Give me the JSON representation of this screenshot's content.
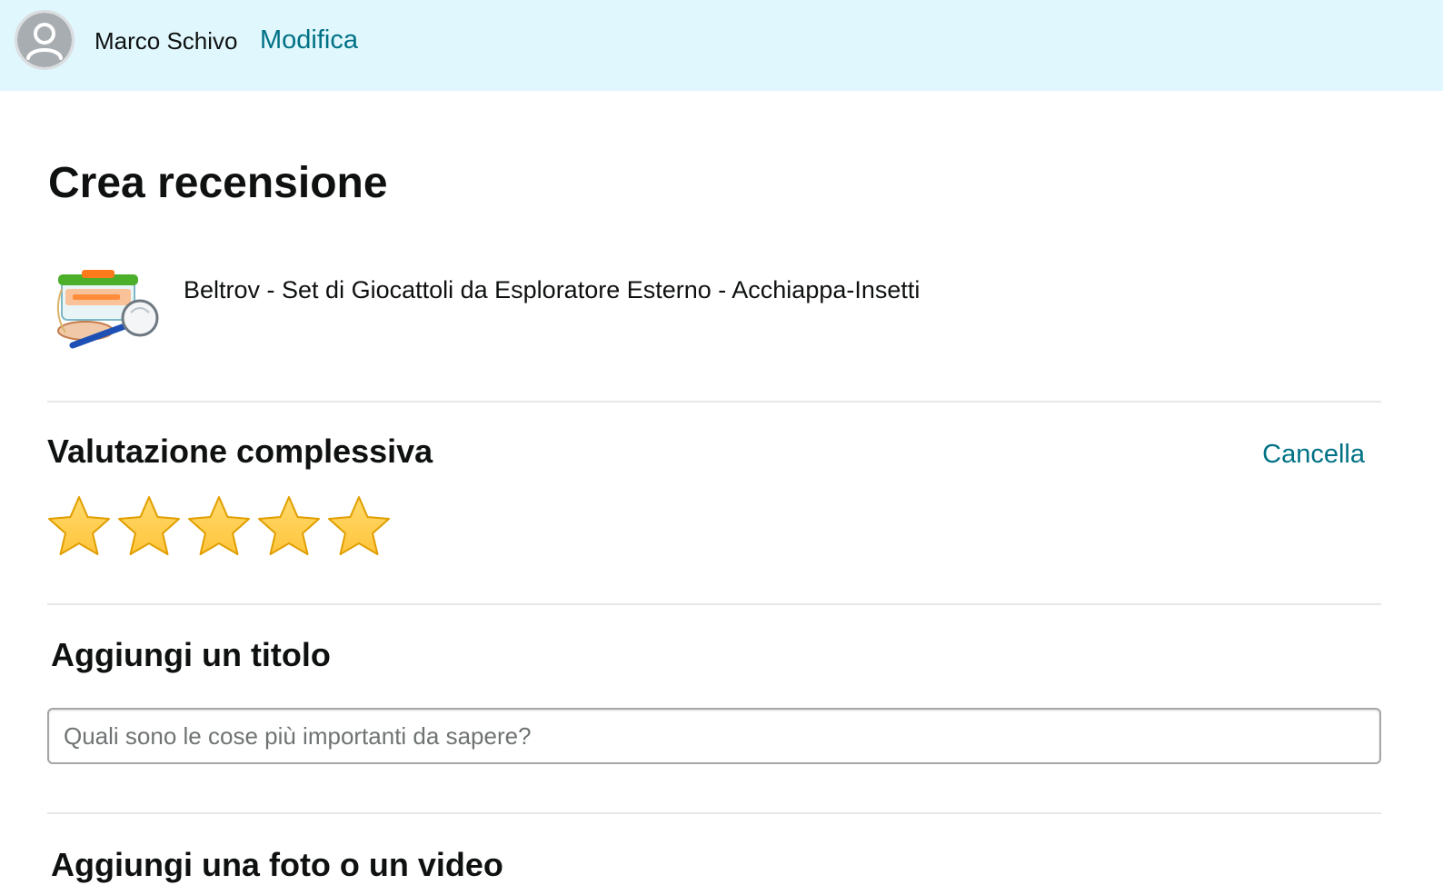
{
  "user": {
    "name": "Marco Schivo",
    "edit_label": "Modifica"
  },
  "page": {
    "title": "Crea recensione"
  },
  "product": {
    "title": "Beltrov - Set di Giocattoli da Esploratore Esterno - Acchiappa-Insetti",
    "image_icon": "bug-catcher-kit-image"
  },
  "rating": {
    "heading": "Valutazione complessiva",
    "clear_label": "Cancella",
    "value": 5,
    "max": 5,
    "star_color": "#ffc53d",
    "star_outline": "#e09e00"
  },
  "review_title": {
    "heading": "Aggiungi un titolo",
    "placeholder": "Quali sono le cose più importanti da sapere?",
    "value": ""
  },
  "media": {
    "heading": "Aggiungi una foto o un video"
  },
  "colors": {
    "header_bg": "#dff7fd",
    "link": "#007185",
    "text": "#0f1111",
    "divider": "#e7e7e7"
  }
}
